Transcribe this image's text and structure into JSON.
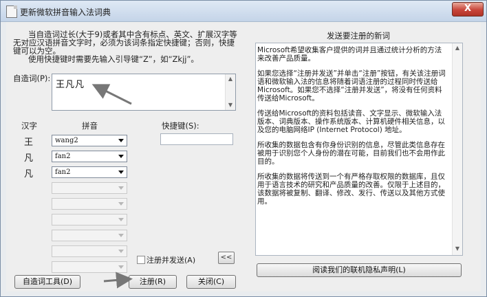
{
  "window": {
    "title": "更新微软拼音输入法词典",
    "close_label": "X"
  },
  "description": {
    "line1": "当自造词过长(大于9)或者其中含有标点、英文、扩展汉字等无对应汉语拼音文字时，必须为该词条指定快捷键；否则，快捷键可以为空。",
    "line2": "使用快捷键时需要先输入引导键“Z”，如“Zkjj”。"
  },
  "custom_word": {
    "label": "自造词(P):",
    "value": "王凡凡"
  },
  "columns": {
    "hanzi": "汉字",
    "pinyin": "拼音",
    "shortcut": "快捷键(S):"
  },
  "rows": [
    {
      "hanzi": "王",
      "pinyin": "wang2"
    },
    {
      "hanzi": "凡",
      "pinyin": "fan2"
    },
    {
      "hanzi": "凡",
      "pinyin": "fan2"
    }
  ],
  "shortcut_value": "",
  "register_and_send": {
    "label": "注册并发送(A)",
    "checked": false
  },
  "collapse_button": "<<",
  "buttons": {
    "tools": "自造词工具(D)",
    "register": "注册(R)",
    "close": "关闭(C)"
  },
  "panel": {
    "title": "发送要注册的新词",
    "paragraphs": [
      "Microsoft希望收集客户提供的词并且通过统计分析的方法来改善产品质量。",
      "如果您选择“注册并发送”并单击“注册”按钮，有关该注册词语和微软输入法的信息将随着词语注册的过程同时传送给Microsoft。如果您不选择“注册并发送”，将没有任何资料传送给Microsoft。",
      "传送给Microsoft的资料包括读音、文字显示、微软输入法版本、词典版本、操作系统版本、计算机硬件相关信息，以及您的电脑网络IP (Internet Protocol) 地址。",
      "所收集的数据包含有你身份识别的信息，尽管此类信息存在被用于识别您个人身份的潜在可能，目前我们也不会用作此目的。",
      "所收集的数据将传送到一个有严格存取权限的数据库，且仅用于语言技术的研究和产品质量的改善。仅限于上述目的，该数据将被复制、翻译、修改、发行、传送以及其他方式使用。"
    ],
    "privacy_button": "阅读我们的联机隐私声明(L)"
  }
}
